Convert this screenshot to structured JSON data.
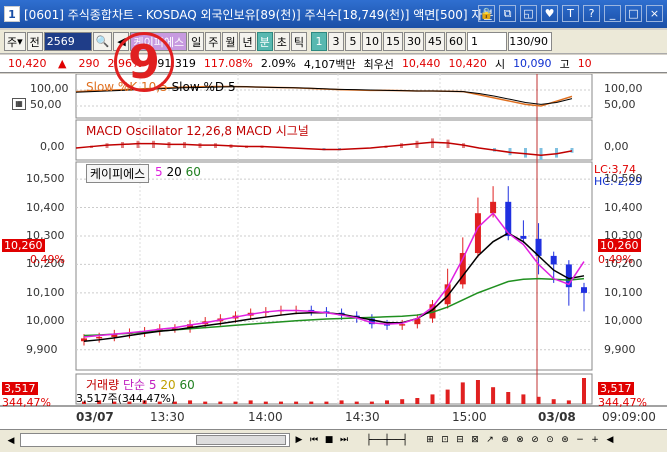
{
  "window": {
    "icon_label": "1",
    "title": "[0601] 주식종합차트 - KOSDAQ 외국인보유[89(천)] 주식수[18,749(천)] 액면[500] 자본",
    "controls": [
      "🔒",
      "⧉",
      "◱",
      "♥",
      "T",
      "?",
      "_",
      "□",
      "×"
    ]
  },
  "toolbar": {
    "type_label": "주",
    "prev_label": "전",
    "code": "2569",
    "stock_name": "케이피에스",
    "periods": [
      "일",
      "주",
      "월",
      "년",
      "분",
      "초",
      "틱"
    ],
    "active_period": "분",
    "intervals": [
      "1",
      "3",
      "5",
      "10",
      "15",
      "30",
      "45",
      "60"
    ],
    "active_interval": "1",
    "unit_value": "1",
    "count_value": "130/90"
  },
  "info": {
    "price": "10,420",
    "change_arrow": "▲",
    "change": "290",
    "change_pct": "2.96%",
    "volume": "391,319",
    "vol_ratio": "117.08%",
    "turnover": "2.09%",
    "amount": "4,107백만",
    "pref_label": "최우선",
    "ask": "10,440",
    "bid": "10,420",
    "open_label": "시",
    "open": "10,090",
    "high_label": "고",
    "high": "10"
  },
  "annotation": {
    "badge": "9"
  },
  "stochastic": {
    "label_k": "Slow %K 10,5",
    "label_d": "Slow %D 5",
    "ticks": [
      "100,00",
      "50,00",
      "0,00"
    ]
  },
  "macd": {
    "label_osc": "MACD Oscillator 12,26,8",
    "label_macd": "MACD",
    "label_signal": "시그널",
    "tick": "0,00"
  },
  "price_chart": {
    "ma_name": "케이피에스",
    "ma_periods": [
      "5",
      "20",
      "60"
    ],
    "lc": "LC:3,74",
    "hc": "HC:-2,29",
    "ticks": [
      "10,500",
      "10,400",
      "10,300",
      "10,260",
      "10,200",
      "10,100",
      "10,000",
      "9,900"
    ],
    "current": "10,260",
    "current_pct": "0.49%"
  },
  "volume_chart": {
    "label": "거래량",
    "ma_label": "단순",
    "ma_periods": [
      "5",
      "20",
      "60"
    ],
    "current": "3,517",
    "current_pct": "344,47%",
    "detail": "3,517주(344,47%)"
  },
  "x_axis": {
    "labels": [
      "03/07",
      "13:30",
      "14:00",
      "14:30",
      "15:00",
      "03/08"
    ],
    "time": "09:09:00"
  },
  "chart_data": {
    "type": "candlestick",
    "x": [
      "13:00",
      "13:05",
      "13:10",
      "13:15",
      "13:20",
      "13:25",
      "13:30",
      "13:35",
      "13:40",
      "13:45",
      "13:50",
      "13:55",
      "14:00",
      "14:05",
      "14:10",
      "14:15",
      "14:20",
      "14:25",
      "14:30",
      "14:35",
      "14:40",
      "14:45",
      "14:50",
      "14:55",
      "15:00",
      "15:05",
      "15:10",
      "15:15",
      "15:20",
      "15:25",
      "15:30",
      "09:00",
      "09:05",
      "09:09"
    ],
    "close": [
      9940,
      9945,
      9955,
      9960,
      9965,
      9975,
      9975,
      9990,
      10000,
      10010,
      10020,
      10030,
      10035,
      10040,
      10040,
      10035,
      10030,
      10020,
      10010,
      9990,
      9985,
      9990,
      10010,
      10060,
      10130,
      10240,
      10380,
      10420,
      10300,
      10290,
      10230,
      10200,
      10120,
      10100
    ],
    "ma5": [
      9945,
      9950,
      9955,
      9960,
      9965,
      9972,
      9978,
      9987,
      9995,
      10005,
      10015,
      10025,
      10033,
      10038,
      10038,
      10035,
      10030,
      10022,
      10012,
      9995,
      9990,
      9993,
      10010,
      10050,
      10120,
      10220,
      10330,
      10380,
      10310,
      10270,
      10200,
      10150,
      10130,
      10210
    ],
    "ma20": [
      9930,
      9935,
      9942,
      9950,
      9958,
      9965,
      9970,
      9978,
      9985,
      9992,
      10000,
      10008,
      10015,
      10022,
      10028,
      10030,
      10030,
      10025,
      10015,
      10005,
      9995,
      9995,
      10010,
      10040,
      10090,
      10160,
      10230,
      10280,
      10310,
      10280,
      10230,
      10180,
      10150,
      10160
    ],
    "ma60": [
      9950,
      9952,
      9955,
      9958,
      9962,
      9966,
      9970,
      9974,
      9978,
      9982,
      9986,
      9990,
      9994,
      9998,
      10002,
      10005,
      10008,
      10010,
      10012,
      10014,
      10016,
      10018,
      10022,
      10032,
      10050,
      10075,
      10100,
      10120,
      10140,
      10148,
      10150,
      10148,
      10145,
      10150
    ],
    "ylim": [
      9850,
      10560
    ],
    "stoch_k": [
      70,
      72,
      74,
      76,
      78,
      80,
      82,
      84,
      85,
      86,
      86,
      85,
      84,
      83,
      82,
      80,
      78,
      76,
      75,
      74,
      74,
      73,
      72,
      72,
      71,
      70,
      60,
      50,
      40,
      30,
      25,
      40,
      55
    ],
    "stoch_d": [
      68,
      70,
      72,
      74,
      76,
      78,
      80,
      82,
      83,
      84,
      85,
      85,
      84,
      83,
      82,
      81,
      79,
      77,
      76,
      75,
      74,
      73,
      72,
      72,
      71,
      70,
      64,
      56,
      46,
      36,
      30,
      36,
      48
    ],
    "macd_osc": [
      0,
      0.02,
      0.04,
      0.05,
      0.06,
      0.06,
      0.05,
      0.05,
      0.04,
      0.04,
      0.03,
      0.02,
      0.02,
      0.01,
      0,
      -0.01,
      -0.02,
      -0.02,
      -0.01,
      0,
      0.02,
      0.04,
      0.06,
      0.08,
      0.07,
      0.04,
      0,
      -0.03,
      -0.06,
      -0.08,
      -0.1,
      -0.08,
      -0.04
    ],
    "volume": [
      2,
      3,
      2,
      2,
      3,
      2,
      2,
      3,
      2,
      2,
      2,
      3,
      2,
      2,
      2,
      2,
      2,
      3,
      2,
      2,
      3,
      4,
      5,
      8,
      12,
      18,
      20,
      14,
      10,
      8,
      6,
      4,
      3,
      3517
    ]
  }
}
